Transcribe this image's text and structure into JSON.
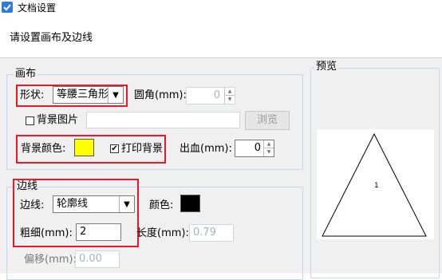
{
  "window": {
    "title": "文档设置",
    "icon": "app-icon"
  },
  "header": {
    "instruction": "请设置画布及边线"
  },
  "canvas": {
    "group_title": "画布",
    "shape_label": "形状:",
    "shape_value": "等腰三角形",
    "corner_label": "圆角(mm):",
    "corner_value": "0",
    "bg_image_label": "背景图片",
    "browse_label": "浏览",
    "bg_color_label": "背景颜色:",
    "bg_color": "#ffff00",
    "print_bg_label": "打印背景",
    "print_bg_checked": true,
    "bleed_label": "出血(mm):",
    "bleed_value": "0"
  },
  "border": {
    "group_title": "边线",
    "line_label": "边线:",
    "line_value": "轮廓线",
    "color_label": "颜色:",
    "color": "#000000",
    "width_label": "粗细(mm):",
    "width_value": "2",
    "length_label": "长度(mm):",
    "length_value": "0.79",
    "offset_label": "偏移(mm):",
    "offset_value": "0.00"
  },
  "preview": {
    "title": "预览",
    "label": "1"
  },
  "colors": {
    "highlight": "#e8192c",
    "group_border": "#c8d5e3",
    "panel_bg": "#f0f0f0"
  }
}
